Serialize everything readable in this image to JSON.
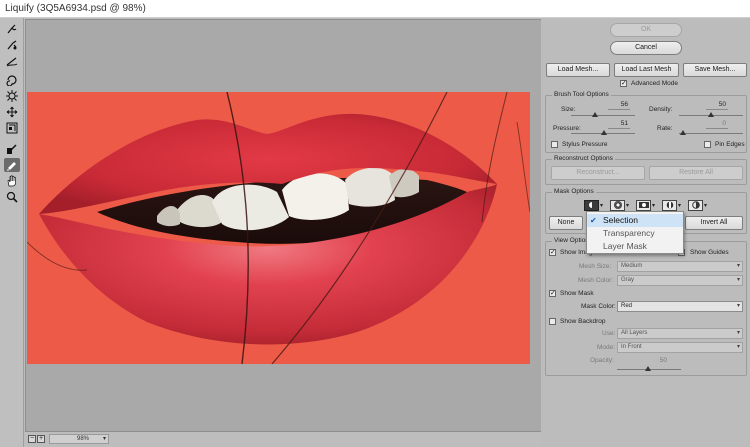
{
  "window": {
    "title": "Liquify (3Q5A6934.psd @ 98%)"
  },
  "tools": [
    "forward-warp-icon",
    "reconstruct-icon",
    "smooth-icon",
    "twirl-icon",
    "pucker-icon",
    "bloat-icon",
    "push-left-icon",
    "freeze-mask-icon",
    "thaw-mask-icon",
    "hand-icon",
    "zoom-icon"
  ],
  "status": {
    "zoom": "98%",
    "minus": "−",
    "plus": "+",
    "dropdown": "▾"
  },
  "panel": {
    "ok": "OK",
    "cancel": "Cancel",
    "load_mesh": "Load Mesh...",
    "load_last_mesh": "Load Last Mesh",
    "save_mesh": "Save Mesh...",
    "advanced_mode": {
      "label": "Advanced Mode",
      "checked": true
    },
    "brush": {
      "title": "Brush Tool Options",
      "size_label": "Size:",
      "size_value": "56",
      "density_label": "Density:",
      "density_value": "50",
      "pressure_label": "Pressure:",
      "pressure_value": "51",
      "rate_label": "Rate:",
      "rate_value": "0",
      "stylus_pressure": "Stylus Pressure",
      "pin_edges": "Pin Edges"
    },
    "reconstruct": {
      "title": "Reconstruct Options",
      "reconstruct_btn": "Reconstruct...",
      "restore_all_btn": "Restore All"
    },
    "mask": {
      "title": "Mask Options",
      "none_btn": "None",
      "invert_all_btn": "Invert All"
    },
    "view": {
      "title": "View Options",
      "show_image": "Show Image",
      "show_guides": "Show Guides",
      "mesh_size_label": "Mesh Size:",
      "mesh_size_value": "Medium",
      "mesh_color_label": "Mesh Color:",
      "mesh_color_value": "Gray",
      "show_mask": "Show Mask",
      "mask_color_label": "Mask Color:",
      "mask_color_value": "Red",
      "show_backdrop": "Show Backdrop",
      "use_label": "Use:",
      "use_value": "All Layers",
      "mode_label": "Mode:",
      "mode_value": "In Front",
      "opacity_label": "Opacity:",
      "opacity_value": "50"
    }
  },
  "mask_dropdown": {
    "items": [
      "Selection",
      "Transparency",
      "Layer Mask"
    ],
    "selected": "Selection"
  },
  "colors": {
    "mask_overlay": "#ec5445",
    "panel_bg": "#bcbcbc",
    "canvas_bg": "#a9a9a9",
    "selection_highlight": "#cfe3f6"
  }
}
